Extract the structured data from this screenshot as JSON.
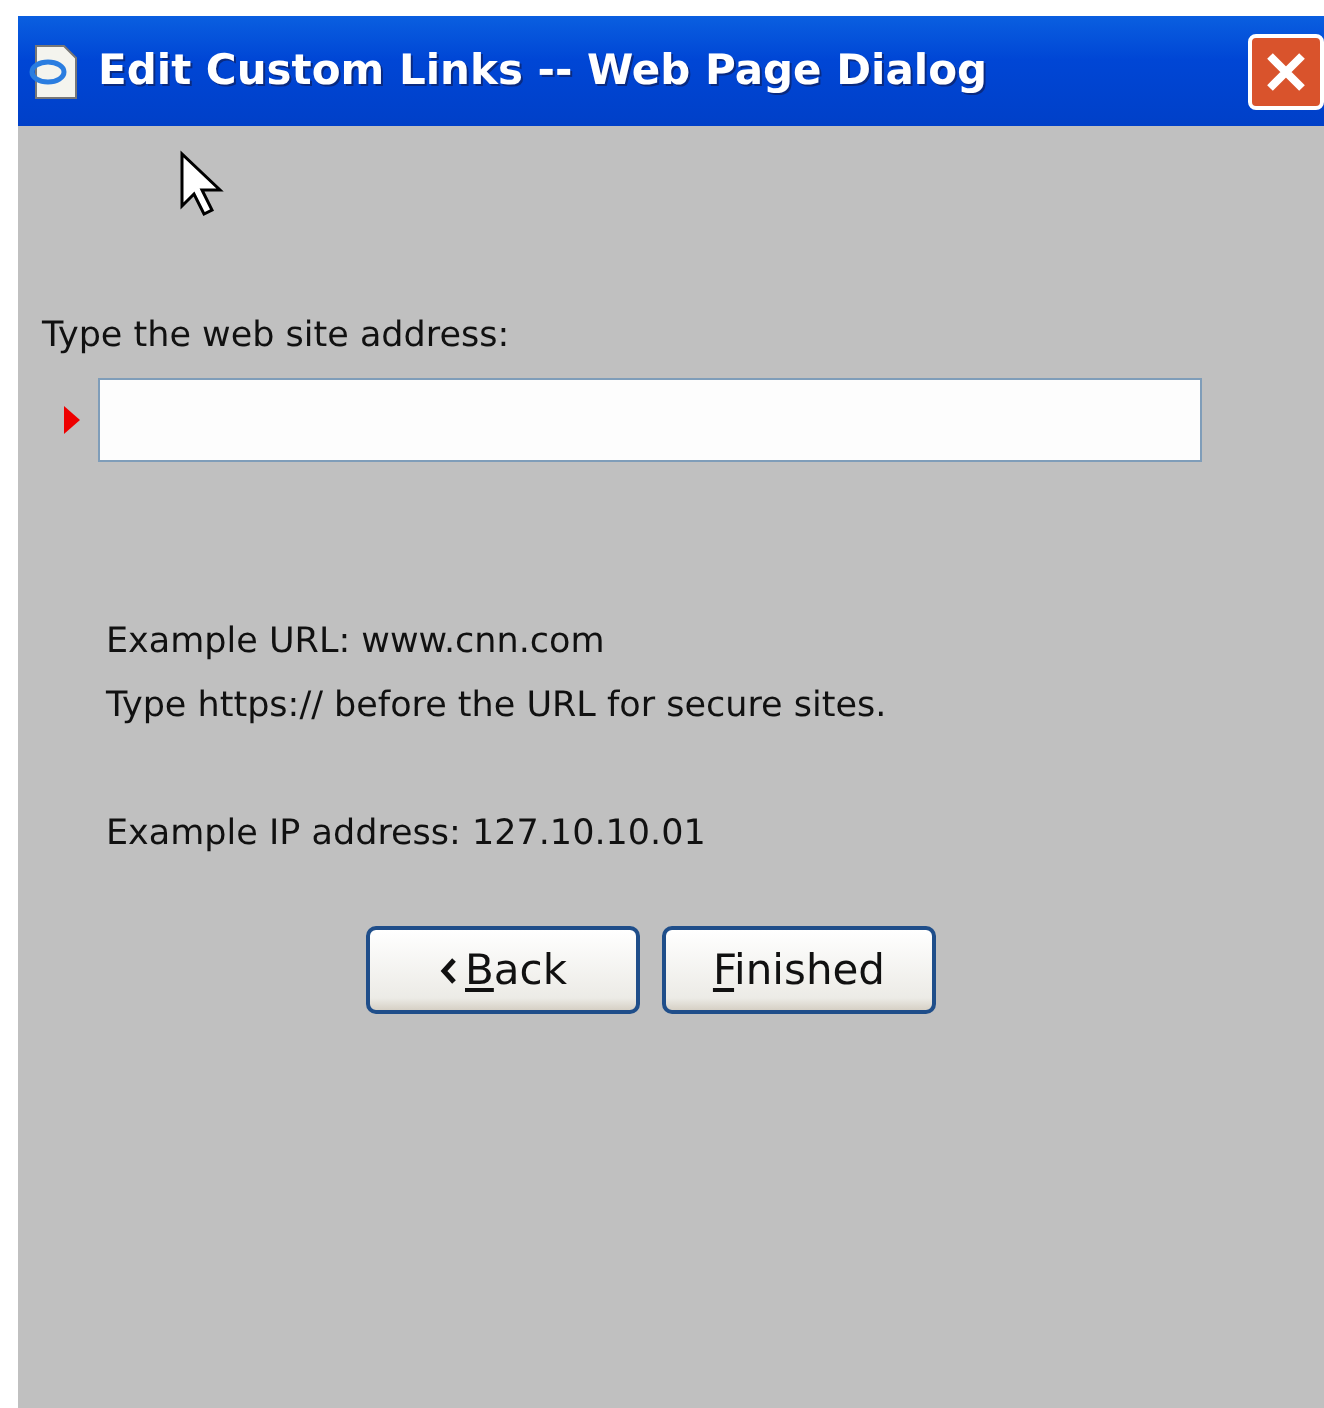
{
  "window": {
    "title": "Edit Custom Links -- Web Page Dialog"
  },
  "address": {
    "label": "Type the web site address:"
  },
  "hint_groups": [
    [
      "Example URL: www.cnn.com",
      "Type https:// before the URL for secure sites."
    ],
    [
      "Example IP address: 127.10.10.01"
    ]
  ],
  "buttons": [
    {
      "kind": "back",
      "hotkey": "B",
      "rest": "ack"
    },
    {
      "kind": "plain",
      "hotkey": "F",
      "rest": "inished"
    }
  ]
}
